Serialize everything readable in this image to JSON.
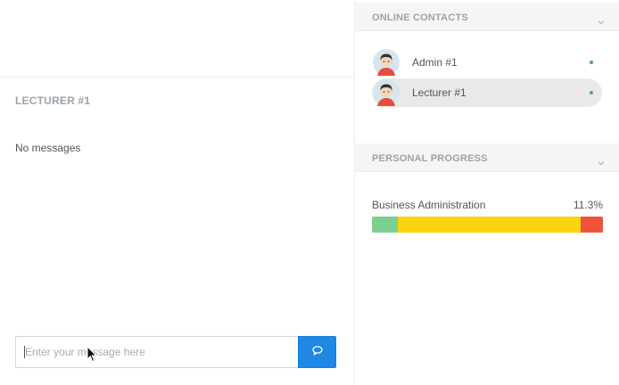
{
  "chat": {
    "title": "LECTURER #1",
    "empty_text": "No messages",
    "input_placeholder": "Enter your message here",
    "input_value": ""
  },
  "icons": {
    "send": "chat-send-icon",
    "chevron": "chevron-down-icon",
    "avatar": "user-avatar-icon",
    "status": "online-dot-icon"
  },
  "online_contacts": {
    "title": "ONLINE CONTACTS",
    "items": [
      {
        "name": "Admin #1",
        "status": "online",
        "selected": false
      },
      {
        "name": "Lecturer #1",
        "status": "online",
        "selected": true
      }
    ]
  },
  "personal_progress": {
    "title": "PERSONAL PROGRESS",
    "course": "Business Administration",
    "percent_label": "11.3%",
    "segments_percent": [
      11.3,
      79,
      9.7
    ],
    "segment_colors": [
      "#7dcf8e",
      "#fbd40d",
      "#f0533c"
    ]
  },
  "colors": {
    "accent": "#1e88e5",
    "online": "#4caf50"
  }
}
